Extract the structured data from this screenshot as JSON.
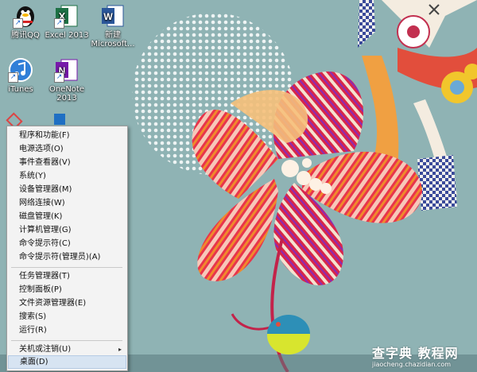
{
  "desktop": {
    "icons": [
      {
        "label": "腾讯QQ",
        "icon": "qq-penguin-icon"
      },
      {
        "label": "Excel 2013",
        "icon": "excel-icon"
      },
      {
        "label": "新建\nMicrosoft...",
        "icon": "word-document-icon"
      },
      {
        "label": "iTunes",
        "icon": "itunes-icon"
      },
      {
        "label": "OneNote\n2013",
        "icon": "onenote-icon"
      }
    ],
    "wallpaper": "abstract-flower-illustration",
    "colors": {
      "background": "#8fb3b4",
      "menu_bg": "#f3f3f3",
      "menu_highlight": "#d7e4f2"
    }
  },
  "context_menu": {
    "groups": [
      [
        "程序和功能(F)",
        "电源选项(O)",
        "事件查看器(V)",
        "系统(Y)",
        "设备管理器(M)",
        "网络连接(W)",
        "磁盘管理(K)",
        "计算机管理(G)",
        "命令提示符(C)",
        "命令提示符(管理员)(A)"
      ],
      [
        "任务管理器(T)",
        "控制面板(P)",
        "文件资源管理器(E)",
        "搜索(S)",
        "运行(R)"
      ],
      [
        "关机或注销(U)",
        "桌面(D)"
      ]
    ],
    "submenu_arrow": "▸",
    "selected": "桌面(D)"
  },
  "watermark": {
    "line1": "查字典 教程网",
    "line2": "jiaocheng.chazidian.com"
  }
}
